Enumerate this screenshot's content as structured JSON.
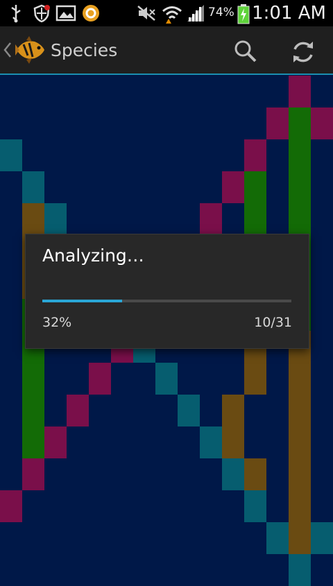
{
  "status_bar": {
    "battery_percent": "74%",
    "time": "1:01 AM",
    "icons": [
      "usb-icon",
      "shield-icon",
      "image-icon",
      "app-circle-icon",
      "mute-icon",
      "wifi-icon",
      "signal-icon",
      "battery-icon"
    ]
  },
  "action_bar": {
    "title": "Species",
    "icons": [
      "back-icon",
      "fish-logo",
      "search-icon",
      "refresh-icon"
    ]
  },
  "colors": {
    "background": "#001848",
    "magenta": "#7a0f4a",
    "green": "#136b06",
    "teal": "#065d6f",
    "gold": "#6a4b12",
    "accent": "#2aa6d6"
  },
  "grid": {
    "rows": [
      "             M ",
      "            MGM",
      "T          M G ",
      " T        MG G ",
      " YT      M G G ",
      " Y T    M  G G ",
      " Y  T  M   G G ",
      " G   TM    Y G ",
      " G   MT    Y Y ",
      " G  M  T   Y Y ",
      " G M    T Y  Y ",
      " GM      TY  Y ",
      " M        TY Y ",
      "M          T Y ",
      "            TYT",
      "             T "
    ]
  },
  "dialog": {
    "title": "Analyzing…",
    "progress_fraction": 0.32,
    "percent_label": "32%",
    "count_label": "10/31"
  }
}
